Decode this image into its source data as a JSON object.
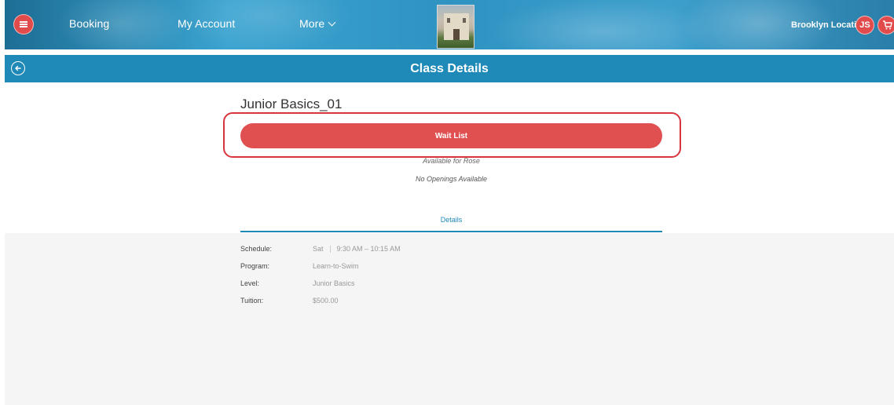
{
  "nav": {
    "booking": "Booking",
    "my_account": "My Account",
    "more": "More",
    "location": "Brooklyn Location",
    "user_initials": "JS"
  },
  "page": {
    "title": "Class Details"
  },
  "class": {
    "name": "Junior Basics_01",
    "action_label": "Wait List",
    "availability": "Available for Rose",
    "openings": "No Openings Available"
  },
  "tabs": {
    "details": "Details"
  },
  "details": {
    "schedule_label": "Schedule:",
    "schedule_day": "Sat",
    "schedule_time": "9:30 AM – 10:15 AM",
    "program_label": "Program:",
    "program_value": "Learn-to-Swim",
    "level_label": "Level:",
    "level_value": "Junior Basics",
    "tuition_label": "Tuition:",
    "tuition_value": "$500.00"
  },
  "colors": {
    "primary_blue": "#1f89b8",
    "accent_red": "#e05050",
    "highlight_red": "#d8343e"
  }
}
